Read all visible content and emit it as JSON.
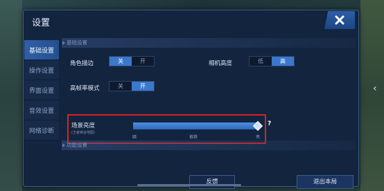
{
  "hud": {
    "left_top": "",
    "left_mid": "",
    "left_low": ""
  },
  "panel": {
    "title": "设置"
  },
  "sidebar": {
    "items": [
      {
        "label": "基础设置",
        "active": true
      },
      {
        "label": "操作设置",
        "active": false
      },
      {
        "label": "界面设置",
        "active": false
      },
      {
        "label": "音效设置",
        "active": false
      },
      {
        "label": "网络诊断",
        "active": false
      }
    ]
  },
  "basic": {
    "header": "基础设置",
    "outline": {
      "label": "角色描边",
      "off": "关",
      "on": "开",
      "value": "关"
    },
    "camera": {
      "label": "相机高度",
      "low": "低",
      "high": "高",
      "value": "高"
    },
    "hfr": {
      "label": "高帧率模式",
      "off": "关",
      "on": "开",
      "value": "开"
    }
  },
  "brightness": {
    "label": "场景亮度",
    "note": "(王者峡谷地图)",
    "value": 1.0,
    "min_label": "暗",
    "mid_label": "推荐",
    "max_label": "亮",
    "help": "?"
  },
  "function": {
    "header": "功能设置"
  },
  "buttons": {
    "feedback": "反馈",
    "quit": "退出本局"
  },
  "colors": {
    "accent": "#3a78cc",
    "highlight": "#d82222",
    "panel": "#13243f"
  }
}
